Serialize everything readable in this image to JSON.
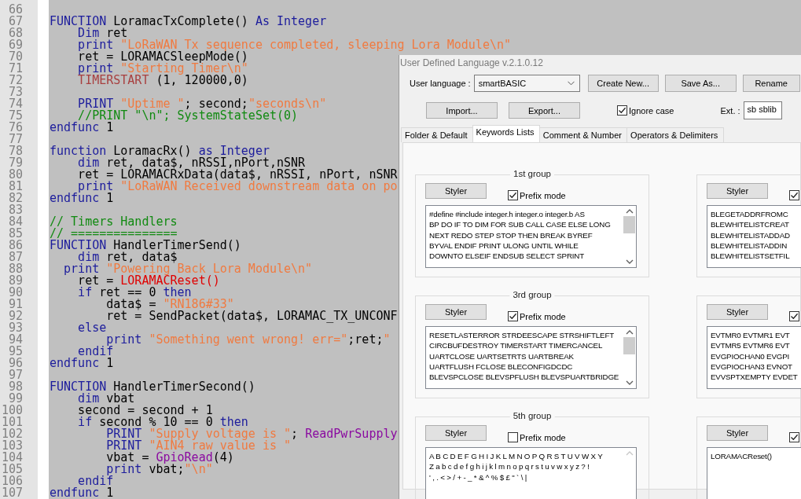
{
  "editor": {
    "lines": [
      {
        "number": "66"
      },
      {
        "number": "67",
        "tokens": [
          {
            "kind": "keyword",
            "text": "FUNCTION"
          },
          {
            "kind": "plain",
            "text": " LoramacTxComplete() "
          },
          {
            "kind": "keyword",
            "text": "As Integer"
          }
        ]
      },
      {
        "number": "68",
        "tokens": [
          {
            "kind": "keyword",
            "text": "    Dim"
          },
          {
            "kind": "plain",
            "text": " ret"
          }
        ]
      },
      {
        "number": "69",
        "tokens": [
          {
            "kind": "keyword",
            "text": "    print"
          },
          {
            "kind": "string",
            "text": " \"LoRaWAN Tx sequence completed, sleeping Lora Module\\n\""
          }
        ]
      },
      {
        "number": "70",
        "tokens": [
          {
            "kind": "plain",
            "text": "    ret = LORAMACSleepMode()"
          }
        ]
      },
      {
        "number": "71",
        "tokens": [
          {
            "kind": "keyword",
            "text": "    print"
          },
          {
            "kind": "string",
            "text": " \"Starting Timer\\n\""
          }
        ]
      },
      {
        "number": "72",
        "tokens": [
          {
            "kind": "timer",
            "text": "    TIMERSTART"
          },
          {
            "kind": "plain",
            "text": " (1, 120000,0)"
          }
        ]
      },
      {
        "number": "73"
      },
      {
        "number": "74",
        "tokens": [
          {
            "kind": "keyword",
            "text": "    PRINT"
          },
          {
            "kind": "string",
            "text": " \"Uptime \""
          },
          {
            "kind": "plain",
            "text": "; second;"
          },
          {
            "kind": "string",
            "text": "\"seconds\\n\""
          }
        ]
      },
      {
        "number": "75",
        "tokens": [
          {
            "kind": "comment",
            "text": "    //PRINT \"\\n\"; SystemStateSet(0)"
          }
        ]
      },
      {
        "number": "76",
        "tokens": [
          {
            "kind": "keyword",
            "text": "endfunc"
          },
          {
            "kind": "plain",
            "text": " 1"
          }
        ]
      },
      {
        "number": "77"
      },
      {
        "number": "78",
        "tokens": [
          {
            "kind": "keyword",
            "text": "function"
          },
          {
            "kind": "plain",
            "text": " LoramacRx() "
          },
          {
            "kind": "keyword",
            "text": "as Integer"
          }
        ]
      },
      {
        "number": "79",
        "tokens": [
          {
            "kind": "keyword",
            "text": "    dim"
          },
          {
            "kind": "plain",
            "text": " ret, data$, nRSSI,nPort,nSNR"
          }
        ]
      },
      {
        "number": "80",
        "tokens": [
          {
            "kind": "plain",
            "text": "    ret = LORAMACRxData(data$, nRSSI, nPort, nSNR"
          }
        ]
      },
      {
        "number": "81",
        "tokens": [
          {
            "kind": "keyword",
            "text": "    print"
          },
          {
            "kind": "string",
            "text": " \"LoRaWAN Received downstream data on po"
          }
        ]
      },
      {
        "number": "82",
        "tokens": [
          {
            "kind": "keyword",
            "text": "endfunc"
          },
          {
            "kind": "plain",
            "text": " 1"
          }
        ]
      },
      {
        "number": "83"
      },
      {
        "number": "84",
        "tokens": [
          {
            "kind": "comment",
            "text": "// Timers Handlers"
          }
        ]
      },
      {
        "number": "85",
        "tokens": [
          {
            "kind": "comment",
            "text": "// ==============="
          }
        ]
      },
      {
        "number": "86",
        "tokens": [
          {
            "kind": "keyword",
            "text": "FUNCTION"
          },
          {
            "kind": "plain",
            "text": " HandlerTimerSend()"
          }
        ]
      },
      {
        "number": "87",
        "tokens": [
          {
            "kind": "keyword",
            "text": "    dim"
          },
          {
            "kind": "plain",
            "text": " ret, data$"
          }
        ]
      },
      {
        "number": "88",
        "tokens": [
          {
            "kind": "keyword",
            "text": "  print"
          },
          {
            "kind": "string",
            "text": " \"Powering Back Lora Module\\n\""
          }
        ]
      },
      {
        "number": "89",
        "tokens": [
          {
            "kind": "plain",
            "text": "    ret = "
          },
          {
            "kind": "builtin",
            "text": "LORAMACReset()"
          }
        ]
      },
      {
        "number": "90",
        "tokens": [
          {
            "kind": "keyword",
            "text": "    if"
          },
          {
            "kind": "plain",
            "text": " ret == 0 "
          },
          {
            "kind": "keyword",
            "text": "then"
          }
        ]
      },
      {
        "number": "91",
        "tokens": [
          {
            "kind": "plain",
            "text": "        data$ = "
          },
          {
            "kind": "string",
            "text": "\"RN186#33\""
          }
        ]
      },
      {
        "number": "92",
        "tokens": [
          {
            "kind": "plain",
            "text": "        ret = SendPacket(data$, LORAMAC_TX_UNCONF"
          }
        ]
      },
      {
        "number": "93",
        "tokens": [
          {
            "kind": "keyword",
            "text": "    else"
          }
        ]
      },
      {
        "number": "94",
        "tokens": [
          {
            "kind": "keyword",
            "text": "        print"
          },
          {
            "kind": "string",
            "text": " \"Something went wrong! err=\""
          },
          {
            "kind": "plain",
            "text": ";ret;"
          },
          {
            "kind": "string",
            "text": "\""
          }
        ]
      },
      {
        "number": "95",
        "tokens": [
          {
            "kind": "keyword",
            "text": "    endif"
          }
        ]
      },
      {
        "number": "96",
        "tokens": [
          {
            "kind": "keyword",
            "text": "endfunc"
          },
          {
            "kind": "plain",
            "text": " 1"
          }
        ]
      },
      {
        "number": "97"
      },
      {
        "number": "98",
        "tokens": [
          {
            "kind": "keyword",
            "text": "FUNCTION"
          },
          {
            "kind": "plain",
            "text": " HandlerTimerSecond()"
          }
        ]
      },
      {
        "number": "99",
        "tokens": [
          {
            "kind": "keyword",
            "text": "    dim"
          },
          {
            "kind": "plain",
            "text": " vbat"
          }
        ]
      },
      {
        "number": "100",
        "tokens": [
          {
            "kind": "plain",
            "text": "    second = second + 1"
          }
        ]
      },
      {
        "number": "101",
        "tokens": [
          {
            "kind": "keyword",
            "text": "    if"
          },
          {
            "kind": "plain",
            "text": " second % 10 == 0 "
          },
          {
            "kind": "keyword",
            "text": "then"
          }
        ]
      },
      {
        "number": "102",
        "tokens": [
          {
            "kind": "keyword",
            "text": "        PRINT"
          },
          {
            "kind": "string",
            "text": " \"Supply voltage is \""
          },
          {
            "kind": "plain",
            "text": "; "
          },
          {
            "kind": "function",
            "text": "ReadPwrSupply"
          }
        ]
      },
      {
        "number": "103",
        "tokens": [
          {
            "kind": "keyword",
            "text": "        PRINT"
          },
          {
            "kind": "string",
            "text": " \"AIN4 raw value is \""
          }
        ]
      },
      {
        "number": "104",
        "tokens": [
          {
            "kind": "plain",
            "text": "        vbat = "
          },
          {
            "kind": "function",
            "text": "GpioRead"
          },
          {
            "kind": "plain",
            "text": "(4)"
          }
        ]
      },
      {
        "number": "105",
        "tokens": [
          {
            "kind": "keyword",
            "text": "        print"
          },
          {
            "kind": "plain",
            "text": " vbat;"
          },
          {
            "kind": "string",
            "text": "\"\\n\""
          }
        ]
      },
      {
        "number": "106",
        "tokens": [
          {
            "kind": "keyword",
            "text": "    endif"
          }
        ]
      },
      {
        "number": "107",
        "tokens": [
          {
            "kind": "keyword",
            "text": "endfunc"
          },
          {
            "kind": "plain",
            "text": " 1"
          }
        ]
      }
    ]
  },
  "dialog": {
    "title": "User Defined Language v.2.1.0.12",
    "user_language": {
      "label": "User language :",
      "value": "smartBASIC"
    },
    "top_buttons": [
      "Create New...",
      "Save As...",
      "Rename"
    ],
    "io_buttons": [
      "Import...",
      "Export..."
    ],
    "ignore_case": {
      "label": "Ignore case",
      "checked": true
    },
    "ext": {
      "label": "Ext. :",
      "value": "sb sblib"
    },
    "tabs": [
      {
        "label": "Folder & Default",
        "selected": false
      },
      {
        "label": "Keywords Lists",
        "selected": true
      },
      {
        "label": "Comment & Number",
        "selected": false
      },
      {
        "label": "Operators & Delimiters",
        "selected": false
      }
    ],
    "left_groups": [
      {
        "title": "1st group",
        "styler": "Styler",
        "prefix": {
          "label": "Prefix mode",
          "checked": true
        },
        "keywords": [
          "#define #include integer.h integer.o integer.b AS",
          "BP DO IF TO DIM FOR SUB CALL CASE ELSE LONG",
          "NEXT REDO STEP STOP THEN BREAK BYREF",
          "BYVAL ENDIF PRINT ULONG UNTIL WHILE",
          "DOWNTO ELSEIF ENDSUB SELECT SPRINT"
        ],
        "scrollbar": {
          "disabled": false
        }
      },
      {
        "title": "3rd group",
        "styler": "Styler",
        "prefix": {
          "label": "Prefix mode",
          "checked": true
        },
        "keywords": [
          "RESETLASTERROR STRDEESCAPE STRSHIFTLEFT",
          "CIRCBUFDESTROY TIMERSTART TIMERCANCEL",
          "UARTCLOSE UARTSETRTS UARTBREAK",
          "UARTFLUSH FCLOSE BLECONFIGDCDC",
          "BLEVSPCLOSE BLEVSPFLUSH BLEVSPUARTBRIDGE"
        ],
        "scrollbar": {
          "disabled": false
        }
      },
      {
        "title": "5th group",
        "styler": "Styler",
        "prefix": {
          "label": "Prefix mode",
          "checked": false
        },
        "keywords": [
          "A B C D E F G H I J K L M N O P Q R S T U V W X Y",
          "Z a b c d e f g h i j k l m n o p q r s t u v w x y z ? !",
          "' , . < > / + - _ * & ^ % $ £ \" ` \\ |"
        ],
        "scrollbar": {
          "disabled": true
        }
      }
    ],
    "right_groups": [
      {
        "styler": "Styler",
        "prefix": {
          "checked": true
        },
        "keywords": [
          "BLEGETADDRFROMC",
          "BLEWHITELISTCREAT",
          "BLEWHITELISTADDAD",
          "BLEWHITELISTADDIN",
          "BLEWHITELISTSETFIL"
        ]
      },
      {
        "styler": "Styler",
        "prefix": {
          "checked": true
        },
        "keywords": [
          "EVTMR0 EVTMR1 EVT",
          "EVTMR5 EVTMR6 EVT",
          "EVGPIOCHAN0 EVGPI",
          "EVGPIOCHAN3 EVNOT",
          "EVVSPTXEMPTY EVDET"
        ]
      },
      {
        "styler": "Styler",
        "prefix": {
          "checked": true
        },
        "keywords": [
          "LORAMACReset()"
        ]
      }
    ]
  }
}
